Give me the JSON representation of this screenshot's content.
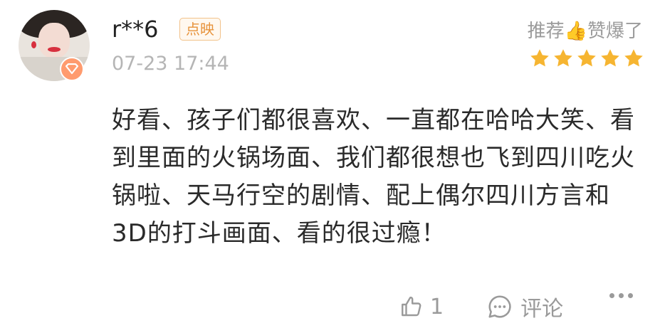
{
  "review": {
    "username": "r**6",
    "tag": "点映",
    "time": "07-23 17:44",
    "recommend": "推荐👍赞爆了",
    "rating": 5,
    "text": "好看、孩子们都很喜欢、一直都在哈哈大笑、看到里面的火锅场面、我们都很想也飞到四川吃火锅啦、天马行空的剧情、配上偶尔四川方言和3D的打斗画面、看的很过瘾！",
    "likes": "1",
    "comment_label": "评论"
  },
  "icons": {
    "avatar_badge": "heart-shield-icon",
    "like": "thumbs-up-icon",
    "comment": "comment-bubble-icon",
    "more": "more-dots-icon",
    "star": "star-icon"
  },
  "colors": {
    "star": "#f6b531",
    "tag_border": "#f2c28a",
    "tag_text": "#e7923a",
    "muted": "#9a9a9a"
  }
}
